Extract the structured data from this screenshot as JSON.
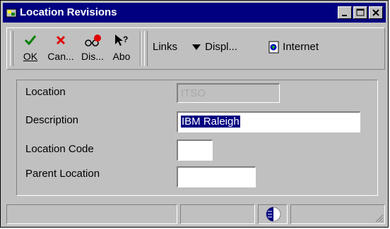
{
  "window": {
    "title": "Location Revisions"
  },
  "titlebar": {
    "icons": [
      "app-icon",
      "minimize-icon",
      "maximize-icon",
      "close-icon"
    ]
  },
  "toolbar": {
    "ok_label": "OK",
    "cancel_label": "Can...",
    "display_label": "Dis...",
    "about_label": "Abo",
    "links_label": "Links",
    "display_menu_label": "Displ...",
    "internet_label": "Internet"
  },
  "form": {
    "location": {
      "label": "Location",
      "value": "ITSO"
    },
    "description": {
      "label": "Description",
      "value": "IBM Raleigh"
    },
    "location_code": {
      "label": "Location Code",
      "value": ""
    },
    "parent_location": {
      "label": "Parent Location",
      "value": ""
    }
  },
  "colors": {
    "titlebar": "#000080",
    "window": "#c0c0c0",
    "selection": "#000080"
  }
}
